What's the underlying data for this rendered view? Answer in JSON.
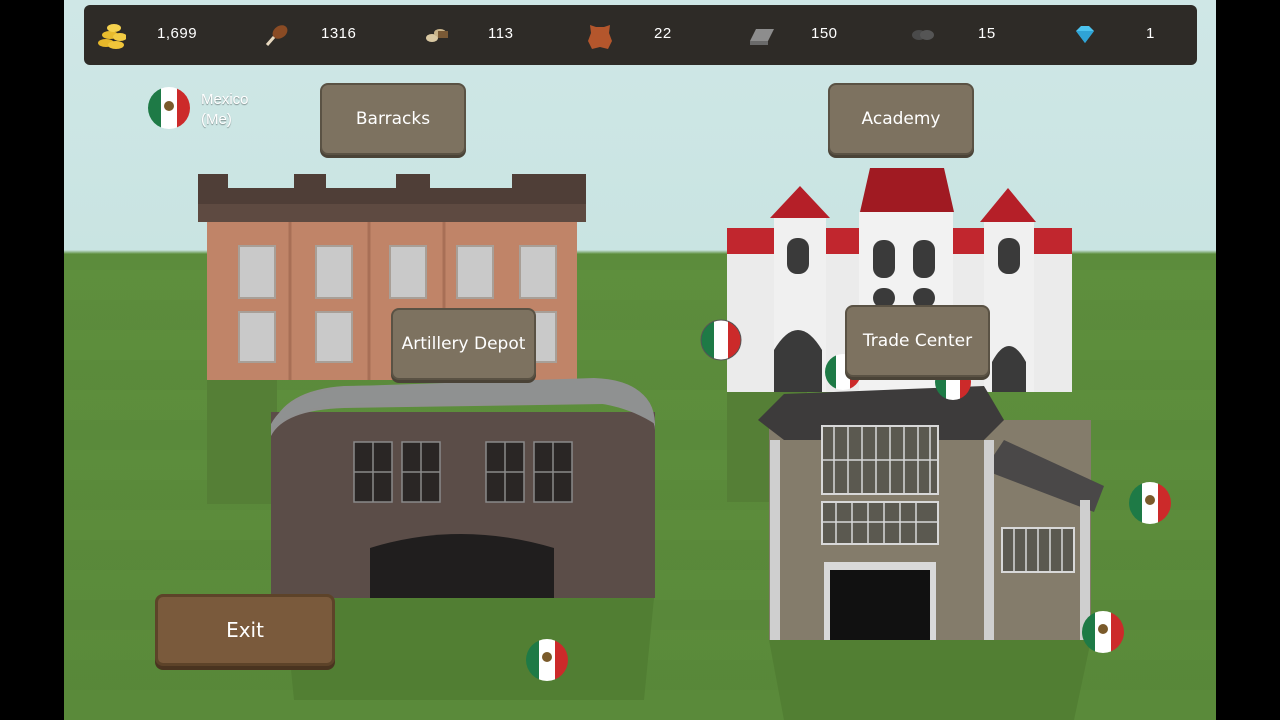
{
  "resources": [
    {
      "name": "gold-coins",
      "value": "1,699"
    },
    {
      "name": "food-drumstick",
      "value": "1316"
    },
    {
      "name": "wood-logs",
      "value": "113"
    },
    {
      "name": "leather-hide",
      "value": "22"
    },
    {
      "name": "iron-ingot",
      "value": "150"
    },
    {
      "name": "coal",
      "value": "15"
    },
    {
      "name": "diamond",
      "value": "1"
    }
  ],
  "player": {
    "name": "Mexico\n(Me)",
    "line1": "Mexico",
    "line2": "(Me)"
  },
  "buildings": {
    "barracks": "Barracks",
    "academy": "Academy",
    "artillery_depot": "Artillery Depot",
    "trade_center": "Trade Center"
  },
  "exit_label": "Exit",
  "colors": {
    "topbar": "#2e2b27",
    "sign": "#7d7260",
    "exit": "#7a5a3c",
    "sky": "#cfe7e6",
    "grass": "#5a8a3a"
  }
}
